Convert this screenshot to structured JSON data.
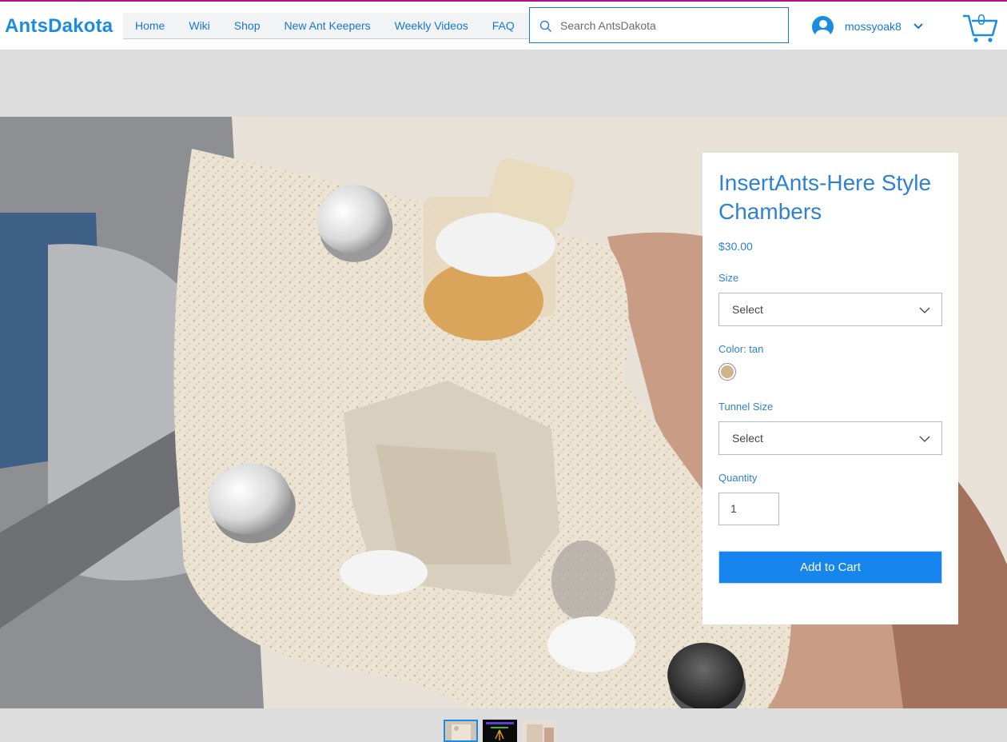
{
  "site": {
    "logo": "AntsDakota"
  },
  "nav": {
    "items": [
      "Home",
      "Wiki",
      "Shop",
      "New Ant Keepers",
      "Weekly Videos",
      "FAQ"
    ]
  },
  "search": {
    "placeholder": "Search AntsDakota",
    "icon": "search-icon"
  },
  "user": {
    "name": "mossyoak8",
    "icon": "user-avatar-icon"
  },
  "cart": {
    "count": "0",
    "icon": "cart-icon"
  },
  "product": {
    "title": "InsertAnts-Here Style Chambers",
    "price": "$30.00",
    "size": {
      "label": "Size",
      "value": "Select"
    },
    "color": {
      "label": "Color: tan",
      "swatch": "#d2b48c"
    },
    "tunnel": {
      "label": "Tunnel Size",
      "value": "Select"
    },
    "quantity": {
      "label": "Quantity",
      "value": "1"
    },
    "add_to_cart": "Add to Cart"
  },
  "gallery": {
    "thumbnail_count": 3,
    "selected_index": 0
  },
  "colors": {
    "accent": "#1b8cdf",
    "button": "#1686ee",
    "topline": "#b0108c"
  }
}
